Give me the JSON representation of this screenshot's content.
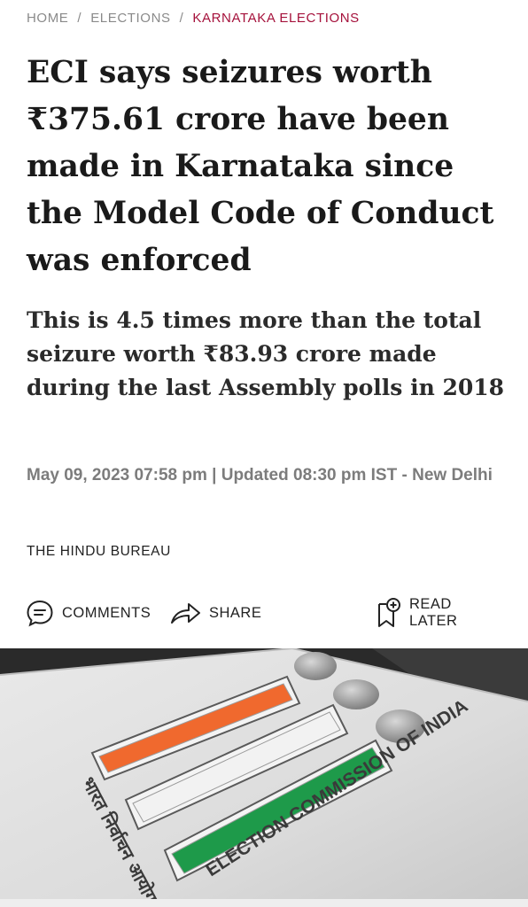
{
  "breadcrumb": [
    {
      "label": "HOME"
    },
    {
      "label": "ELECTIONS"
    },
    {
      "label": "KARNATAKA ELECTIONS"
    }
  ],
  "breadcrumb_separator": "/",
  "article": {
    "title": "ECI says seizures worth ₹375.61 crore have been made in Karnataka since the Model Code of Conduct was enforced",
    "subtitle": "This is 4.5 times more than the total seizure worth ₹83.93 crore made during the last Assembly polls in 2018",
    "dateline": "May 09, 2023 07:58 pm | Updated 08:30 pm IST - New Delhi",
    "byline": "THE HINDU BUREAU"
  },
  "actions": {
    "comments": {
      "label": "COMMENTS",
      "icon": "comment-bubble-icon"
    },
    "share": {
      "label": "SHARE",
      "icon": "share-arrow-icon"
    },
    "read_later": {
      "label": "READ LATER",
      "icon": "bookmark-plus-icon"
    }
  },
  "hero_image": {
    "signage_text_en": "ELECTION COMMISSION OF INDIA",
    "signage_text_hi": "भारत निर्वाचन आयोग",
    "stripe_colors": [
      "#f0692e",
      "#f2f2f2",
      "#1e9a4a"
    ]
  },
  "colors": {
    "accent": "#a5113b",
    "muted": "#8a8a8a"
  }
}
